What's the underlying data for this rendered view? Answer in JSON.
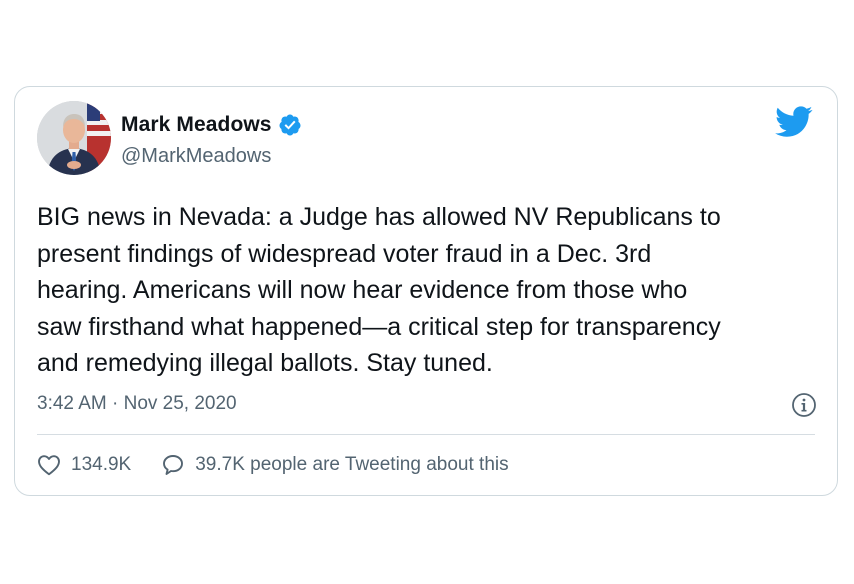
{
  "tweet": {
    "author": {
      "display_name": "Mark Meadows",
      "handle": "@MarkMeadows",
      "verified": true
    },
    "text": "BIG news in Nevada: a Judge has allowed NV Republicans to\npresent findings of widespread voter fraud in a Dec. 3rd\nhearing. Americans will now hear evidence from those who\nsaw firsthand what happened—a critical step for transparency\nand remedying illegal ballots. Stay tuned.",
    "timestamp": "3:42 AM · Nov 25, 2020",
    "likes": "134.9K",
    "conversation": "39.7K people are Tweeting about this"
  },
  "icons": {
    "brand": "twitter-bird-icon",
    "verified": "verified-badge-icon",
    "info": "info-icon",
    "like": "heart-icon",
    "reply": "speech-bubble-icon"
  },
  "colors": {
    "brand_blue": "#1d9bf0",
    "text_primary": "#0f1419",
    "text_secondary": "#536471",
    "border": "#cfd9de"
  }
}
